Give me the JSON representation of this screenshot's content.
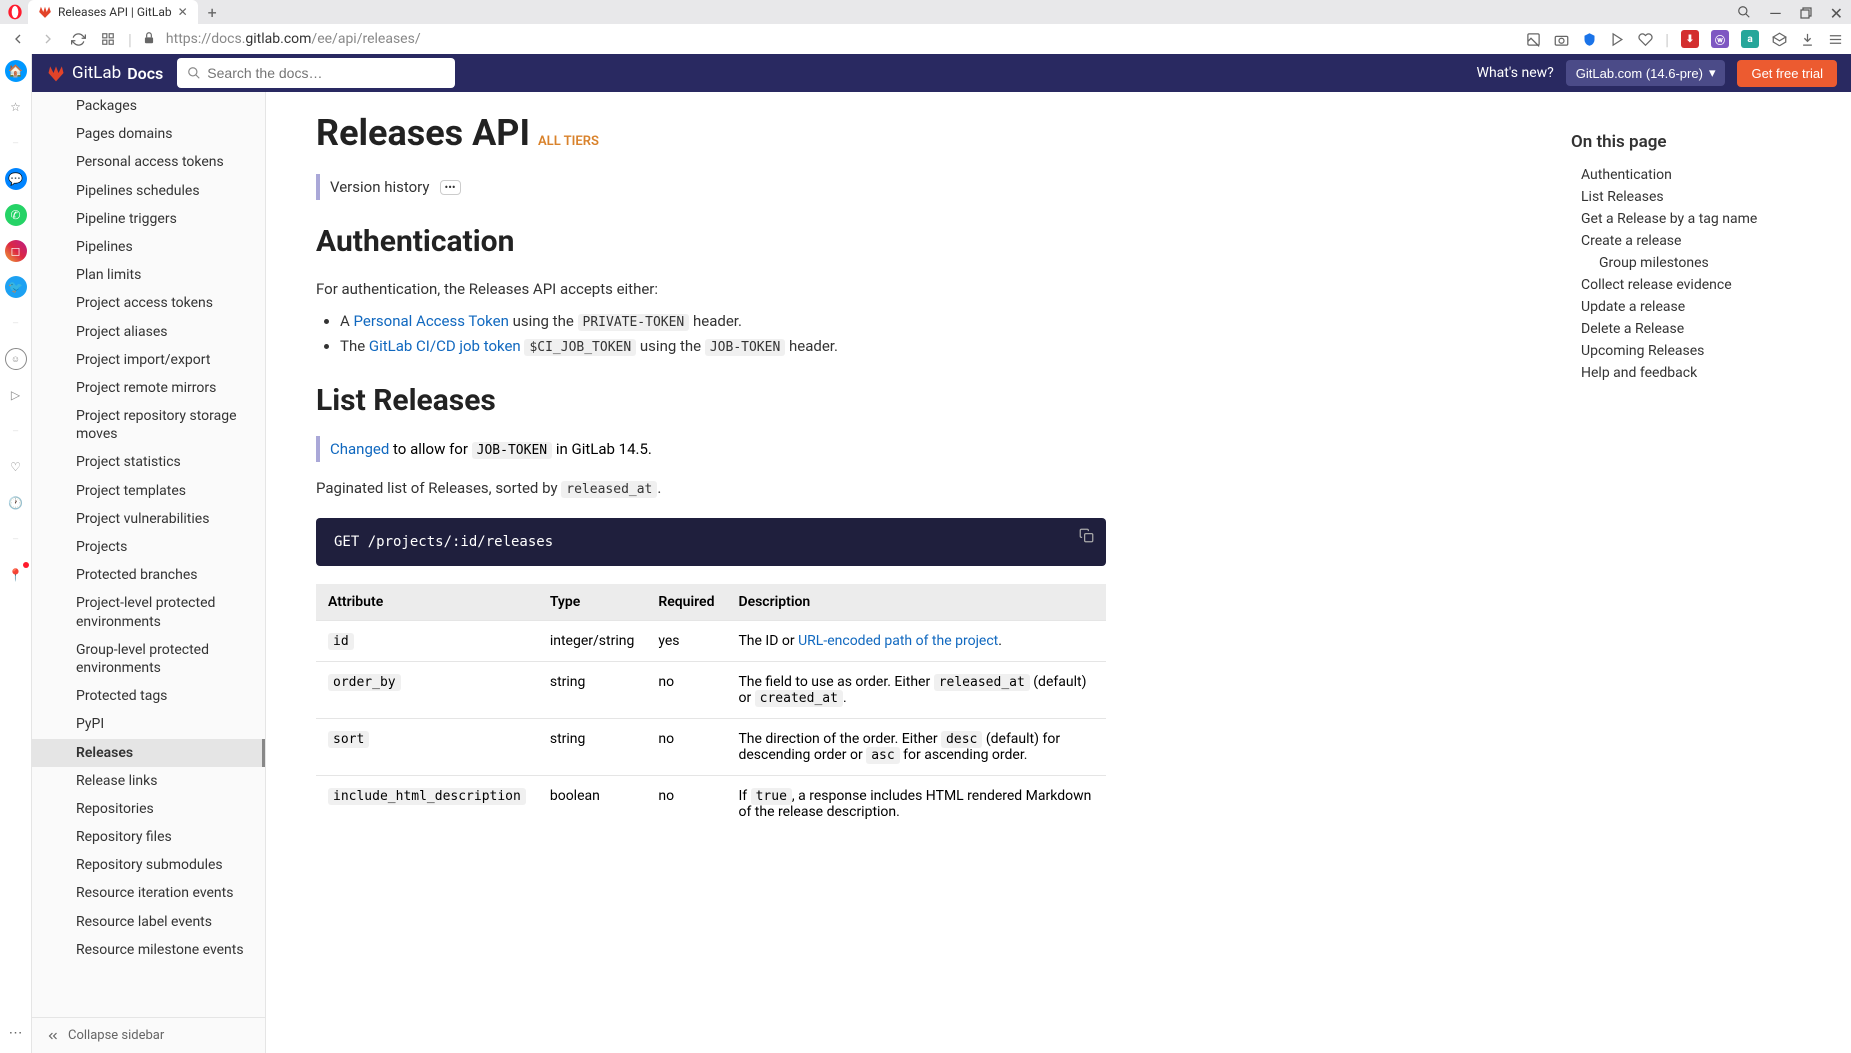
{
  "browser": {
    "tab_title": "Releases API | GitLab",
    "url_prefix": "https://docs.",
    "url_domain": "gitlab.com",
    "url_suffix": "/ee/api/releases/"
  },
  "navbar": {
    "brand": "GitLab",
    "docs": "Docs",
    "search_placeholder": "Search the docs…",
    "whats_new": "What's new?",
    "version": "GitLab.com (14.6-pre)",
    "trial": "Get free trial"
  },
  "sidebar": {
    "items": [
      "Packages",
      "Pages domains",
      "Personal access tokens",
      "Pipelines schedules",
      "Pipeline triggers",
      "Pipelines",
      "Plan limits",
      "Project access tokens",
      "Project aliases",
      "Project import/export",
      "Project remote mirrors",
      "Project repository storage moves",
      "Project statistics",
      "Project templates",
      "Project vulnerabilities",
      "Projects",
      "Protected branches",
      "Project-level protected environments",
      "Group-level protected environments",
      "Protected tags",
      "PyPI",
      "Releases",
      "Release links",
      "Repositories",
      "Repository files",
      "Repository submodules",
      "Resource iteration events",
      "Resource label events",
      "Resource milestone events"
    ],
    "active_index": 21,
    "collapse": "Collapse sidebar"
  },
  "toc": {
    "heading": "On this page",
    "items": [
      {
        "label": "Authentication",
        "indent": false
      },
      {
        "label": "List Releases",
        "indent": false
      },
      {
        "label": "Get a Release by a tag name",
        "indent": false
      },
      {
        "label": "Create a release",
        "indent": false
      },
      {
        "label": "Group milestones",
        "indent": true
      },
      {
        "label": "Collect release evidence",
        "indent": false
      },
      {
        "label": "Update a release",
        "indent": false
      },
      {
        "label": "Delete a Release",
        "indent": false
      },
      {
        "label": "Upcoming Releases",
        "indent": false
      },
      {
        "label": "Help and feedback",
        "indent": false
      }
    ]
  },
  "page": {
    "title": "Releases API",
    "tier": "ALL TIERS",
    "version_history": "Version history",
    "auth": {
      "heading": "Authentication",
      "p1": "For authentication, the Releases API accepts either:",
      "li1_a": "A ",
      "li1_link": "Personal Access Token",
      "li1_b": " using the ",
      "li1_code": "PRIVATE-TOKEN",
      "li1_c": " header.",
      "li2_a": "The ",
      "li2_link": "GitLab CI/CD job token",
      "li2_code1": "$CI_JOB_TOKEN",
      "li2_b": " using the ",
      "li2_code2": "JOB-TOKEN",
      "li2_c": " header."
    },
    "list": {
      "heading": "List Releases",
      "changed_label": "Changed",
      "changed_text": " to allow for ",
      "changed_code": "JOB-TOKEN",
      "changed_suffix": " in GitLab 14.5.",
      "p1_a": "Paginated list of Releases, sorted by ",
      "p1_code": "released_at",
      "p1_b": ".",
      "code": "GET /projects/:id/releases",
      "table": {
        "headers": [
          "Attribute",
          "Type",
          "Required",
          "Description"
        ],
        "rows": [
          {
            "attr": "id",
            "type": "integer/string",
            "req": "yes",
            "desc_a": "The ID or ",
            "desc_link": "URL-encoded path of the project",
            "desc_b": "."
          },
          {
            "attr": "order_by",
            "type": "string",
            "req": "no",
            "desc_a": "The field to use as order. Either ",
            "code1": "released_at",
            "mid": " (default) or ",
            "code2": "created_at",
            "desc_b": "."
          },
          {
            "attr": "sort",
            "type": "string",
            "req": "no",
            "desc_a": "The direction of the order. Either ",
            "code1": "desc",
            "mid": " (default) for descending order or ",
            "code2": "asc",
            "desc_b": " for ascending order."
          },
          {
            "attr": "include_html_description",
            "type": "boolean",
            "req": "no",
            "desc_a": "If ",
            "code1": "true",
            "mid": ", a response includes HTML rendered Markdown of the release description.",
            "code2": "",
            "desc_b": ""
          }
        ]
      }
    }
  }
}
